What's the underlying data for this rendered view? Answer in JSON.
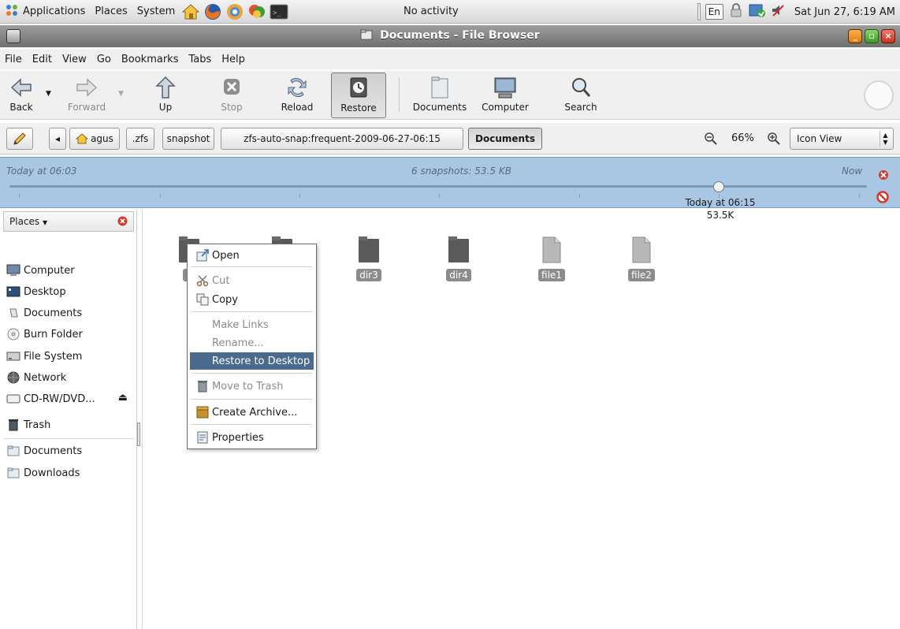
{
  "panel": {
    "menus": [
      "Applications",
      "Places",
      "System"
    ],
    "activity": "No activity",
    "keyboard": "En",
    "clock": "Sat Jun 27,  6:19 AM"
  },
  "window": {
    "title": "Documents - File Browser"
  },
  "menubar": [
    "File",
    "Edit",
    "View",
    "Go",
    "Bookmarks",
    "Tabs",
    "Help"
  ],
  "toolbar": {
    "back": "Back",
    "forward": "Forward",
    "up": "Up",
    "stop": "Stop",
    "reload": "Reload",
    "restore": "Restore",
    "documents": "Documents",
    "computer": "Computer",
    "search": "Search"
  },
  "location": {
    "path": [
      "agus",
      ".zfs",
      "snapshot",
      "zfs-auto-snap:frequent-2009-06-27-06:15",
      "Documents"
    ],
    "zoom": "66%",
    "view": "Icon View"
  },
  "timeslider": {
    "start": "Today at 06:03",
    "summary": "6 snapshots: 53.5 KB",
    "end": "Now",
    "selected_time": "Today at 06:15",
    "selected_size": "53.5K",
    "position_fraction": 0.82
  },
  "sidebar": {
    "header": "Places",
    "items": [
      "Computer",
      "Desktop",
      "Documents",
      "Burn Folder",
      "File System",
      "Network",
      "CD-RW/DVD...",
      "Trash"
    ],
    "bookmarks": [
      "Documents",
      "Downloads"
    ]
  },
  "files": [
    {
      "name": "d",
      "type": "folder"
    },
    {
      "name": "",
      "type": "folder"
    },
    {
      "name": "dir3",
      "type": "folder"
    },
    {
      "name": "dir4",
      "type": "folder"
    },
    {
      "name": "file1",
      "type": "file"
    },
    {
      "name": "file2",
      "type": "file"
    }
  ],
  "context_menu": {
    "open": "Open",
    "cut": "Cut",
    "copy": "Copy",
    "make_links": "Make Links",
    "rename": "Rename...",
    "restore_to_desktop": "Restore to Desktop",
    "move_to_trash": "Move to Trash",
    "create_archive": "Create Archive...",
    "properties": "Properties"
  },
  "colors": {
    "timebar_bg": "#a9c6e3",
    "menu_highlight": "#4a6b8d",
    "file_label_bg": "#8c8c8c"
  }
}
